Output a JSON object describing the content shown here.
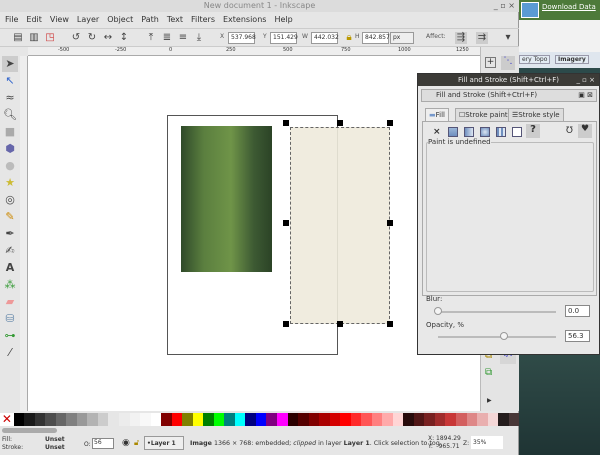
{
  "window": {
    "title": "New document 1 - Inkscape"
  },
  "background": {
    "download_label": "Download Data",
    "tabs": [
      "ery Topo",
      "Imagery"
    ]
  },
  "menu": [
    "File",
    "Edit",
    "View",
    "Layer",
    "Object",
    "Path",
    "Text",
    "Filters",
    "Extensions",
    "Help"
  ],
  "toolbar": {
    "x_label": "X",
    "x": "537.968",
    "y_label": "Y",
    "y": "151.429",
    "w_label": "W",
    "w": "442.032",
    "h_label": "H",
    "h": "842.857",
    "unit": "px",
    "affect_label": "Affect:"
  },
  "ruler": {
    "ticks": [
      "-500",
      "-250",
      "0",
      "250",
      "500",
      "750",
      "1000",
      "1250"
    ]
  },
  "tools": [
    "selector",
    "node",
    "tweak",
    "zoom",
    "rect",
    "3dbox",
    "ellipse",
    "star",
    "spiral",
    "pencil",
    "pen",
    "calligraphy",
    "text",
    "spray",
    "eraser",
    "bucket",
    "connector",
    "dropper",
    "gradient"
  ],
  "palette": [
    "#000000",
    "#1a1a1a",
    "#333333",
    "#4d4d4d",
    "#666666",
    "#808080",
    "#999999",
    "#b3b3b3",
    "#cccccc",
    "#e6e6e6",
    "#ececec",
    "#f2f2f2",
    "#f8f8f8",
    "#ffffff",
    "#800000",
    "#ff0000",
    "#808000",
    "#ffff00",
    "#008000",
    "#00ff00",
    "#008080",
    "#00ffff",
    "#000080",
    "#0000ff",
    "#800080",
    "#ff00ff",
    "#2b0000",
    "#550000",
    "#800000",
    "#aa0000",
    "#d40000",
    "#ff0000",
    "#ff2a2a",
    "#ff5555",
    "#ff8080",
    "#ffaaaa",
    "#ffd5d5",
    "#280b0b",
    "#501616",
    "#782121",
    "#a02c2c",
    "#c83737",
    "#d35f5f",
    "#de8787",
    "#e9afaf",
    "#f4d7d7",
    "#241c1c",
    "#483737"
  ],
  "status": {
    "fill_label": "Fill:",
    "fill": "Unset",
    "stroke_label": "Stroke:",
    "stroke": "Unset",
    "opacity_label": "O:",
    "opacity": "56",
    "layer": "•Layer 1",
    "msg_b1": "Image",
    "msg1": " 1366 × 768: embedded; ",
    "msg_i": "clipped",
    "msg2": " in layer ",
    "msg_b2": "Layer 1",
    "msg3": ". Click selection to tog.",
    "cx": "X: 1894.29",
    "cy": "Y:   965.71",
    "zoom_label": "Z:",
    "zoom": "35%"
  },
  "dialog": {
    "title": "Fill and Stroke (Shift+Ctrl+F)",
    "inner_title": "Fill and Stroke (Shift+Ctrl+F)",
    "tabs": [
      "Fill",
      "Stroke paint",
      "Stroke style"
    ],
    "paint_status": "Paint is undefined",
    "blur_label": "Blur:",
    "blur": "0.0",
    "blur_value": 0,
    "opacity_label": "Opacity, %",
    "opacity": "56.3",
    "opacity_value": 56.3
  }
}
